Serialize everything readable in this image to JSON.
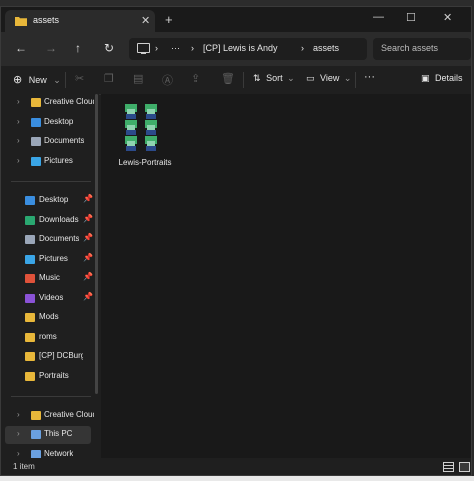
{
  "tab": {
    "title": "assets"
  },
  "address": {
    "segments": [
      "[CP] Lewis is Andy",
      "assets"
    ]
  },
  "search": {
    "placeholder": "Search assets"
  },
  "toolbar": {
    "new_label": "New",
    "sort_label": "Sort",
    "view_label": "View",
    "details_label": "Details"
  },
  "sidebar": {
    "top_items": [
      {
        "label": "Creative Cloud",
        "icon": "folder-icon",
        "color": "#e8b73a"
      },
      {
        "label": "Desktop",
        "icon": "desktop-icon",
        "color": "#3a8ee0"
      },
      {
        "label": "Documents",
        "icon": "documents-icon",
        "color": "#9aa6b8"
      },
      {
        "label": "Pictures",
        "icon": "pictures-icon",
        "color": "#3aa5e6"
      }
    ],
    "quick_access": [
      {
        "label": "Desktop",
        "icon": "desktop-icon",
        "color": "#3a8ee0",
        "pinned": true
      },
      {
        "label": "Downloads",
        "icon": "downloads-icon",
        "color": "#2aa871",
        "pinned": true
      },
      {
        "label": "Documents",
        "icon": "documents-icon",
        "color": "#9aa6b8",
        "pinned": true
      },
      {
        "label": "Pictures",
        "icon": "pictures-icon",
        "color": "#3aa5e6",
        "pinned": true
      },
      {
        "label": "Music",
        "icon": "music-icon",
        "color": "#e0523a",
        "pinned": true
      },
      {
        "label": "Videos",
        "icon": "videos-icon",
        "color": "#8a52d6",
        "pinned": true
      },
      {
        "label": "Mods",
        "icon": "folder-icon",
        "color": "#e8b73a",
        "pinned": false
      },
      {
        "label": "roms",
        "icon": "folder-icon",
        "color": "#e8b73a",
        "pinned": false
      },
      {
        "label": "[CP] DCBurger's",
        "icon": "folder-icon",
        "color": "#e8b73a",
        "pinned": false
      },
      {
        "label": "Portraits",
        "icon": "folder-icon",
        "color": "#e8b73a",
        "pinned": false
      }
    ],
    "bottom_items": [
      {
        "label": "Creative Cloud F",
        "icon": "folder-icon",
        "color": "#e8b73a"
      },
      {
        "label": "This PC",
        "icon": "pc-icon",
        "color": "#6aa0e0"
      },
      {
        "label": "Network",
        "icon": "network-icon",
        "color": "#6aa0e0"
      }
    ]
  },
  "content": {
    "items": [
      {
        "name": "Lewis-Portraits",
        "icon": "image-file-icon"
      }
    ]
  },
  "status": {
    "count": "1 item"
  },
  "colors": {
    "accent": "#3a8ee0",
    "folder": "#e8b73a"
  }
}
